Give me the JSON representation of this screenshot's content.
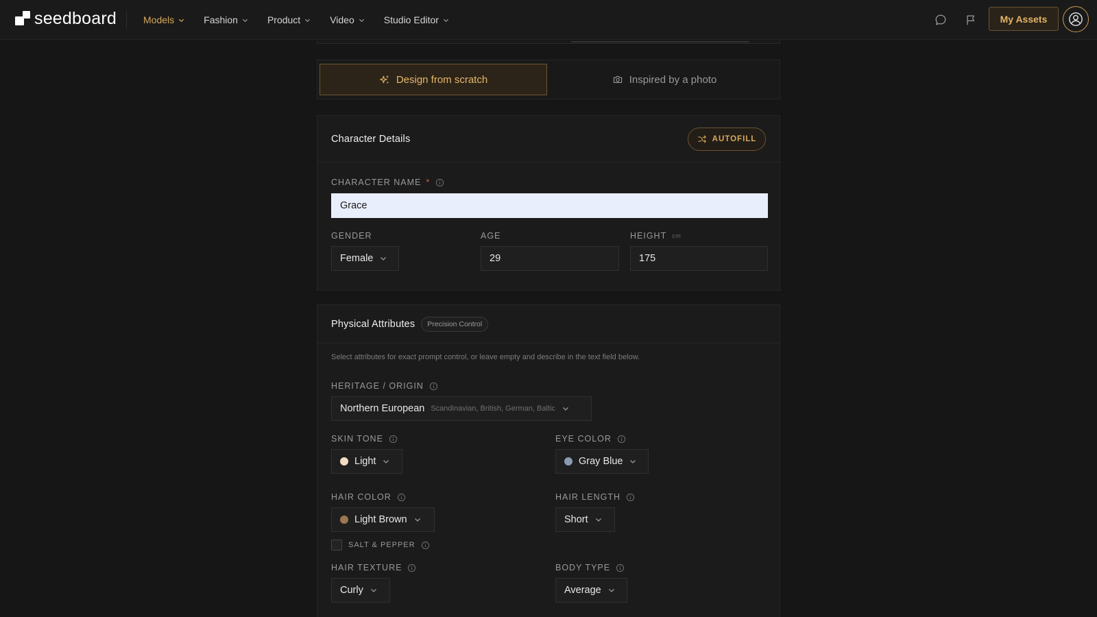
{
  "app": {
    "logo_text": "seedboard"
  },
  "nav": {
    "items": [
      {
        "label": "Models",
        "active": true
      },
      {
        "label": "Fashion",
        "active": false
      },
      {
        "label": "Product",
        "active": false
      },
      {
        "label": "Video",
        "active": false
      },
      {
        "label": "Studio Editor",
        "active": false
      }
    ],
    "my_assets_label": "My Assets"
  },
  "mode": {
    "design_label": "Design from scratch",
    "photo_label": "Inspired by a photo"
  },
  "character_details": {
    "title": "Character Details",
    "autofill_label": "AUTOFILL",
    "name_label": "CHARACTER NAME",
    "name_required": "*",
    "name_value": "Grace",
    "gender_label": "GENDER",
    "gender_value": "Female",
    "age_label": "AGE",
    "age_value": "29",
    "height_label": "HEIGHT",
    "height_unit": "cm",
    "height_value": "175"
  },
  "physical_attributes": {
    "title": "Physical Attributes",
    "badge": "Precision Control",
    "hint": "Select attributes for exact prompt control, or leave empty and describe in the text field below.",
    "heritage_label": "HERITAGE / ORIGIN",
    "heritage_value": "Northern European",
    "heritage_sub": "Scandinavian, British, German, Baltic",
    "skin_tone_label": "SKIN TONE",
    "skin_tone_value": "Light",
    "eye_color_label": "EYE COLOR",
    "eye_color_value": "Gray Blue",
    "hair_color_label": "HAIR COLOR",
    "hair_color_value": "Light Brown",
    "hair_length_label": "HAIR LENGTH",
    "hair_length_value": "Short",
    "salt_pepper_label": "SALT & PEPPER",
    "salt_pepper_checked": false,
    "hair_texture_label": "HAIR TEXTURE",
    "hair_texture_value": "Curly",
    "body_type_label": "BODY TYPE",
    "body_type_value": "Average"
  },
  "colors": {
    "accent": "#d7a95a",
    "skin_light": "#f3dcc2",
    "eye_gray_blue": "#8a9bb0",
    "hair_light_brown": "#9b7752",
    "required": "#e0574a"
  },
  "icons": [
    "chevron-down-icon",
    "chat-icon",
    "flag-icon",
    "user-circle-icon",
    "sparkles-icon",
    "camera-icon",
    "shuffle-icon",
    "info-icon"
  ]
}
